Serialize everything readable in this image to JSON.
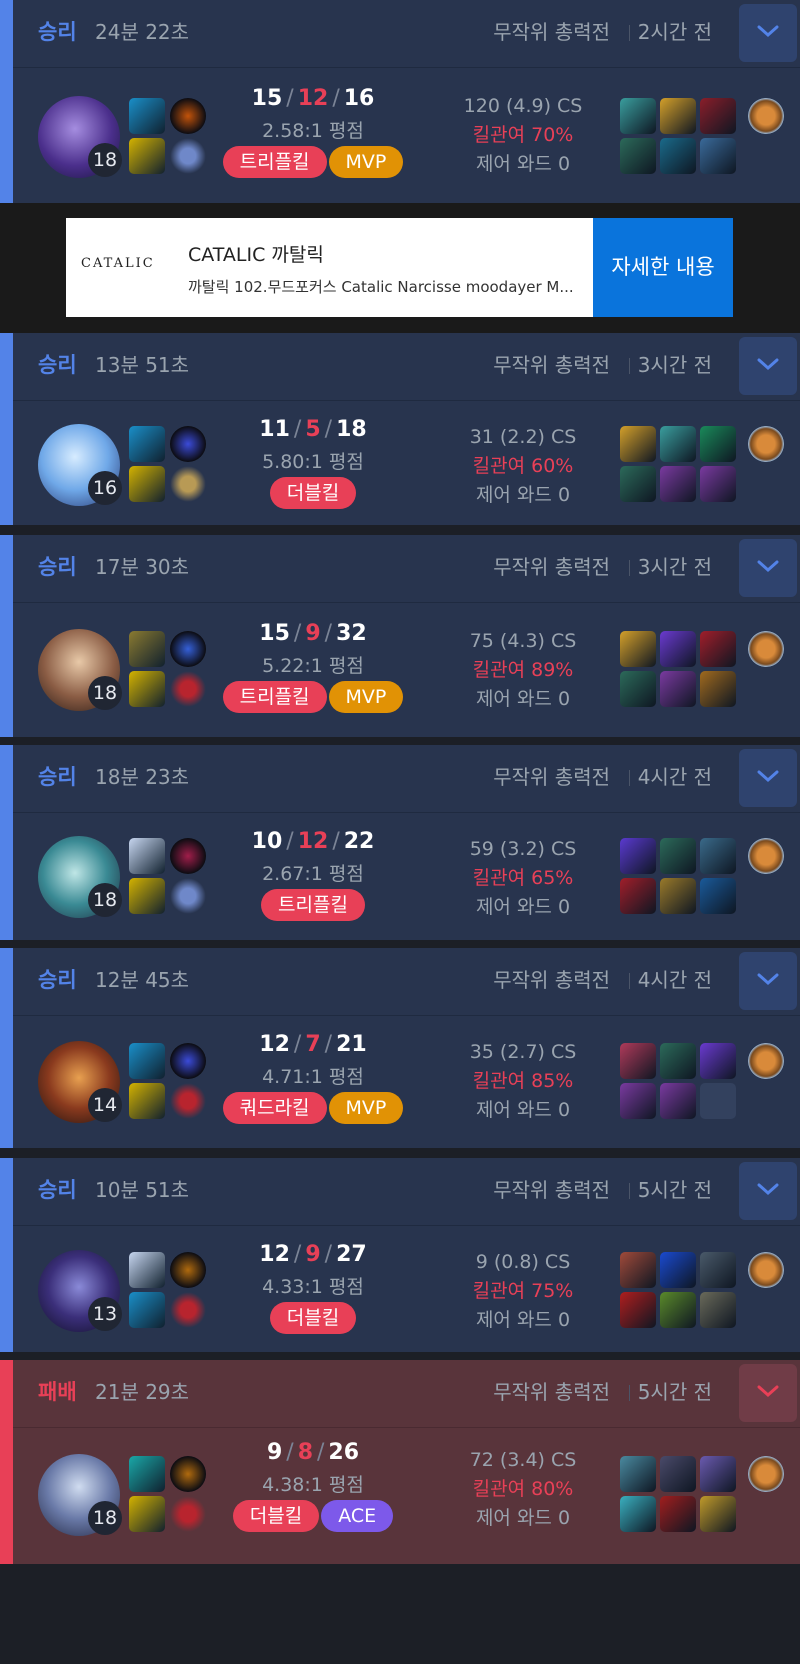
{
  "ad": {
    "logo": "CATALIC",
    "title": "CATALIC 까탈릭",
    "description": "까탈릭 102.무드포커스 Catalic Narcisse moodayer M...",
    "cta": "자세한 내용"
  },
  "labels": {
    "kda_slash": "/",
    "cs_suffix": "CS",
    "ratio_suffix": "평점",
    "kp_prefix": "킬관여",
    "wards_prefix": "제어 와드"
  },
  "colors": {
    "win": "#5383e8",
    "loss": "#e84057",
    "mvp": "#e19205",
    "ace": "#7d59ea"
  },
  "matches": [
    {
      "result": "승리",
      "duration": "24분 22초",
      "mode": "무작위 총력전",
      "time_ago": "2시간 전",
      "level": "18",
      "kills": "15",
      "deaths": "12",
      "assists": "16",
      "ratio": "2.58:1 평점",
      "badges": [
        "트리플킬",
        "MVP"
      ],
      "cs": "120 (4.9) CS",
      "kill_participation": "킬관여 70%",
      "control_wards": "제어 와드 0"
    },
    {
      "result": "승리",
      "duration": "13분 51초",
      "mode": "무작위 총력전",
      "time_ago": "3시간 전",
      "level": "16",
      "kills": "11",
      "deaths": "5",
      "assists": "18",
      "ratio": "5.80:1 평점",
      "badges": [
        "더블킬"
      ],
      "cs": "31 (2.2) CS",
      "kill_participation": "킬관여 60%",
      "control_wards": "제어 와드 0"
    },
    {
      "result": "승리",
      "duration": "17분 30초",
      "mode": "무작위 총력전",
      "time_ago": "3시간 전",
      "level": "18",
      "kills": "15",
      "deaths": "9",
      "assists": "32",
      "ratio": "5.22:1 평점",
      "badges": [
        "트리플킬",
        "MVP"
      ],
      "cs": "75 (4.3) CS",
      "kill_participation": "킬관여 89%",
      "control_wards": "제어 와드 0"
    },
    {
      "result": "승리",
      "duration": "18분 23초",
      "mode": "무작위 총력전",
      "time_ago": "4시간 전",
      "level": "18",
      "kills": "10",
      "deaths": "12",
      "assists": "22",
      "ratio": "2.67:1 평점",
      "badges": [
        "트리플킬"
      ],
      "cs": "59 (3.2) CS",
      "kill_participation": "킬관여 65%",
      "control_wards": "제어 와드 0"
    },
    {
      "result": "승리",
      "duration": "12분 45초",
      "mode": "무작위 총력전",
      "time_ago": "4시간 전",
      "level": "14",
      "kills": "12",
      "deaths": "7",
      "assists": "21",
      "ratio": "4.71:1 평점",
      "badges": [
        "쿼드라킬",
        "MVP"
      ],
      "cs": "35 (2.7) CS",
      "kill_participation": "킬관여 85%",
      "control_wards": "제어 와드 0"
    },
    {
      "result": "승리",
      "duration": "10분 51초",
      "mode": "무작위 총력전",
      "time_ago": "5시간 전",
      "level": "13",
      "kills": "12",
      "deaths": "9",
      "assists": "27",
      "ratio": "4.33:1 평점",
      "badges": [
        "더블킬"
      ],
      "cs": "9 (0.8) CS",
      "kill_participation": "킬관여 75%",
      "control_wards": "제어 와드 0"
    },
    {
      "result": "패배",
      "duration": "21분 29초",
      "mode": "무작위 총력전",
      "time_ago": "5시간 전",
      "level": "18",
      "kills": "9",
      "deaths": "8",
      "assists": "26",
      "ratio": "4.38:1 평점",
      "badges": [
        "더블킬",
        "ACE"
      ],
      "cs": "72 (3.4) CS",
      "kill_participation": "킬관여 80%",
      "control_wards": "제어 와드 0"
    }
  ]
}
